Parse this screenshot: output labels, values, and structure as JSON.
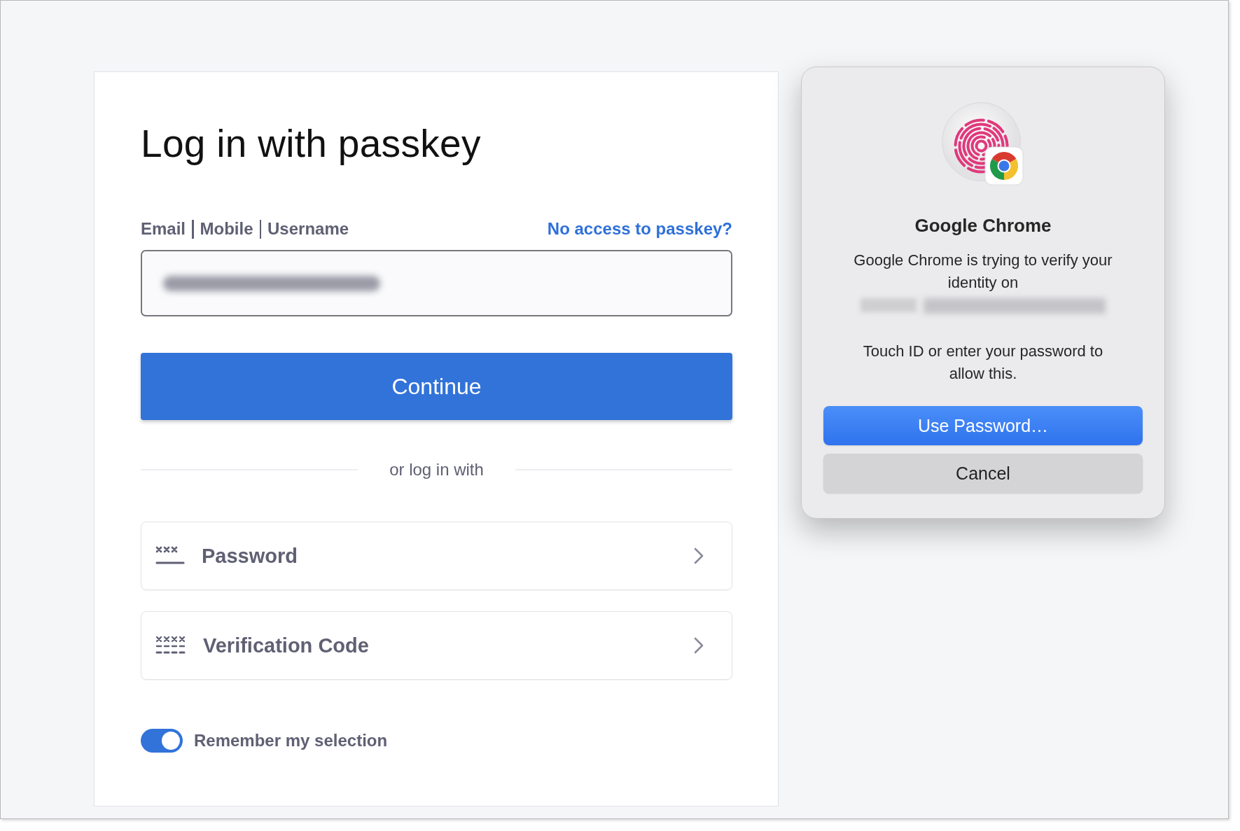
{
  "login": {
    "title": "Log in with passkey",
    "identifier_labels": [
      "Email",
      "Mobile",
      "Username"
    ],
    "help_link": "No access to passkey?",
    "continue_button": "Continue",
    "divider": "or log in with",
    "options": [
      {
        "kind": "password",
        "label": "Password"
      },
      {
        "kind": "code",
        "label": "Verification Code"
      }
    ],
    "remember": {
      "label": "Remember my selection",
      "on": true
    }
  },
  "dialog": {
    "title": "Google Chrome",
    "message": "Google Chrome is trying to verify your identity on",
    "prompt": "Touch ID or enter your password to allow this.",
    "buttons": [
      {
        "kind": "primary",
        "label": "Use Password…"
      },
      {
        "kind": "secondary",
        "label": "Cancel"
      }
    ]
  }
}
